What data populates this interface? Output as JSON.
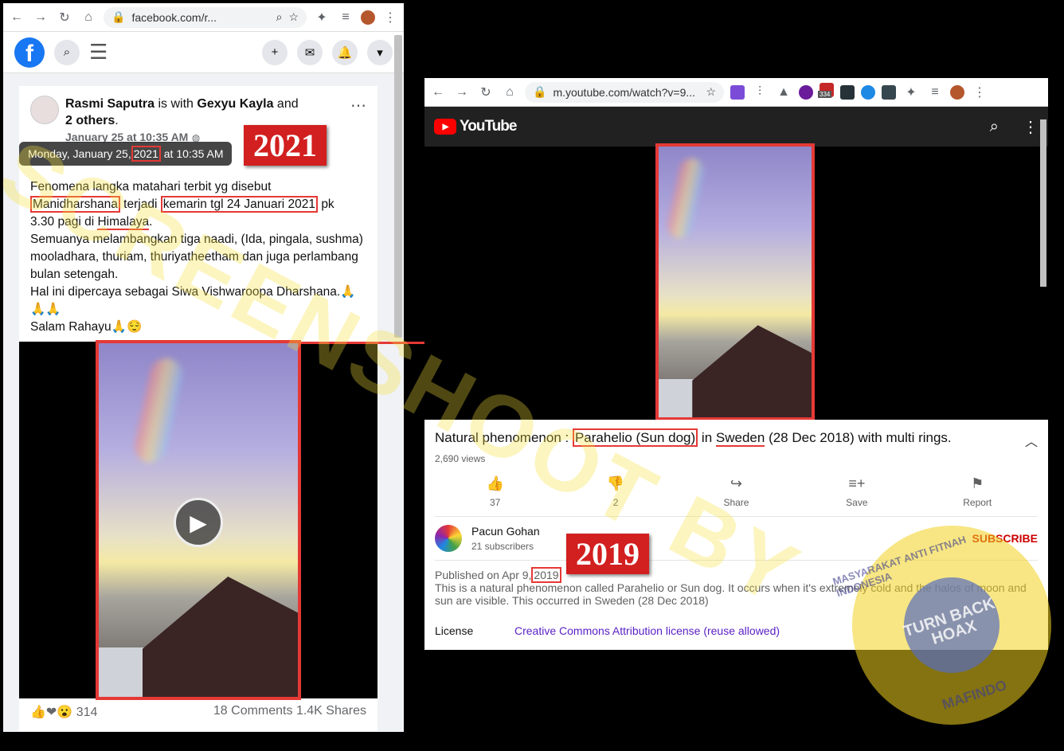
{
  "facebook": {
    "url": "facebook.com/r...",
    "author": "Rasmi Saputra",
    "with_text": "is with",
    "tagged": "Gexyu Kayla",
    "and_text": "and",
    "others": "2 others",
    "period": ".",
    "date": "January 25 at 10:35 AM",
    "tooltip_pre": "Monday, January 25,",
    "tooltip_year": "2021",
    "tooltip_post": "at 10:35 AM",
    "year_tag": "2021",
    "text": {
      "l1": "Fenomena langka matahari terbit  yg disebut",
      "manid": "Manidharshana",
      "terjadi": "terjadi",
      "kemarin": "kemarin tgl 24 Januari 2021",
      "pk": "pk",
      "l3a": "3.30 pagi di",
      "himalaya": "Himalaya",
      "dot": ".",
      "l4": "Semuanya melambangkan tiga naadi, (Ida, pingala, sushma) mooladhara, thuriam, thuriyatheetham dan juga perlambang bulan setengah.",
      "l5": "Hal ini dipercaya sebagai  Siwa Vishwaroopa Dharshana.🙏🙏🙏",
      "l6": "Salam Rahayu🙏😌"
    },
    "reaction_count": "314",
    "comments": "18 Comments",
    "shares": "1.4K Shares"
  },
  "youtube": {
    "url": "m.youtube.com/watch?v=9...",
    "ext_badge": "334",
    "logo_text": "YouTube",
    "title_pre": "Natural phenomenon :",
    "title_hl": "Parahelio (Sun dog)",
    "title_in": "in",
    "title_sweden": "Sweden",
    "title_post": "(28 Dec 2018) with multi rings.",
    "views": "2,690 views",
    "actions": [
      {
        "label": "37",
        "icon": "thumbs-up-icon"
      },
      {
        "label": "2",
        "icon": "thumbs-down-icon"
      },
      {
        "label": "Share",
        "icon": "share-icon"
      },
      {
        "label": "Save",
        "icon": "save-icon"
      },
      {
        "label": "Report",
        "icon": "flag-icon"
      }
    ],
    "channel": "Pacun Gohan",
    "subscribers": "21 subscribers",
    "subscribe": "SUBSCRIBE",
    "published_pre": "Published on Apr 9,",
    "published_year": "2019",
    "description": "This is a natural phenomenon called Parahelio or Sun dog. It occurs when it's extremely cold and the halos of moon and sun are visible. This occurred in Sweden (28 Dec 2018)",
    "license_label": "License",
    "license_value": "Creative Commons Attribution license (reuse allowed)",
    "year_tag": "2019"
  },
  "overlay": {
    "watermark": "SCREENSHOOT BY",
    "seal_center": "TURN BACK HOAX",
    "seal_ring_top": "MASYARAKAT ANTI FITNAH INDONESIA",
    "seal_ring_bottom": "MAFINDO"
  },
  "colors": {
    "highlight": "#e53935",
    "tag": "#d21f1f",
    "facebook": "#1877f2",
    "youtube_red": "#ff0000"
  }
}
